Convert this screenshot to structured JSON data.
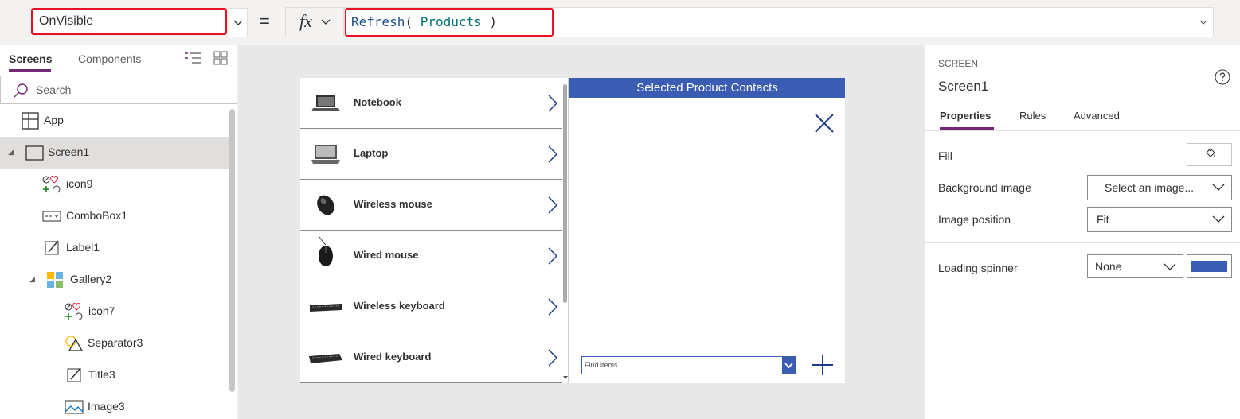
{
  "formula_bar": {
    "property": "OnVisible",
    "equals": "=",
    "fx_label": "fx",
    "formula": {
      "fn": "Refresh",
      "open": "( ",
      "arg": "Products",
      "close": " )"
    }
  },
  "tree_view": {
    "tabs": [
      "Screens",
      "Components"
    ],
    "active_tab": "Screens",
    "search_placeholder": "Search",
    "items": [
      {
        "label": "App",
        "icon": "app-icon"
      },
      {
        "label": "Screen1",
        "icon": "screen-icon",
        "selected": true
      },
      {
        "label": "icon9",
        "icon": "icon-control-icon"
      },
      {
        "label": "ComboBox1",
        "icon": "combobox-icon"
      },
      {
        "label": "Label1",
        "icon": "label-icon"
      },
      {
        "label": "Gallery2",
        "icon": "gallery-icon"
      },
      {
        "label": "icon7",
        "icon": "icon-control-icon"
      },
      {
        "label": "Separator3",
        "icon": "shapes-icon"
      },
      {
        "label": "Title3",
        "icon": "label-icon"
      },
      {
        "label": "Image3",
        "icon": "image-icon"
      }
    ]
  },
  "canvas": {
    "gallery_items": [
      "Notebook",
      "Laptop",
      "Wireless mouse",
      "Wired mouse",
      "Wireless keyboard",
      "Wired keyboard"
    ],
    "contacts_title": "Selected Product Contacts",
    "find_placeholder": "Find items"
  },
  "properties_pane": {
    "kind": "SCREEN",
    "name": "Screen1",
    "tabs": [
      "Properties",
      "Rules",
      "Advanced"
    ],
    "active_tab": "Properties",
    "fill_label": "Fill",
    "background_image_label": "Background image",
    "background_image_value": "Select an image...",
    "image_position_label": "Image position",
    "image_position_value": "Fit",
    "loading_spinner_label": "Loading spinner",
    "loading_spinner_value": "None",
    "spinner_color": "#3a5db3"
  },
  "colors": {
    "accent": "#742774",
    "highlight": "#e81123",
    "brand_blue": "#3a5db3"
  }
}
